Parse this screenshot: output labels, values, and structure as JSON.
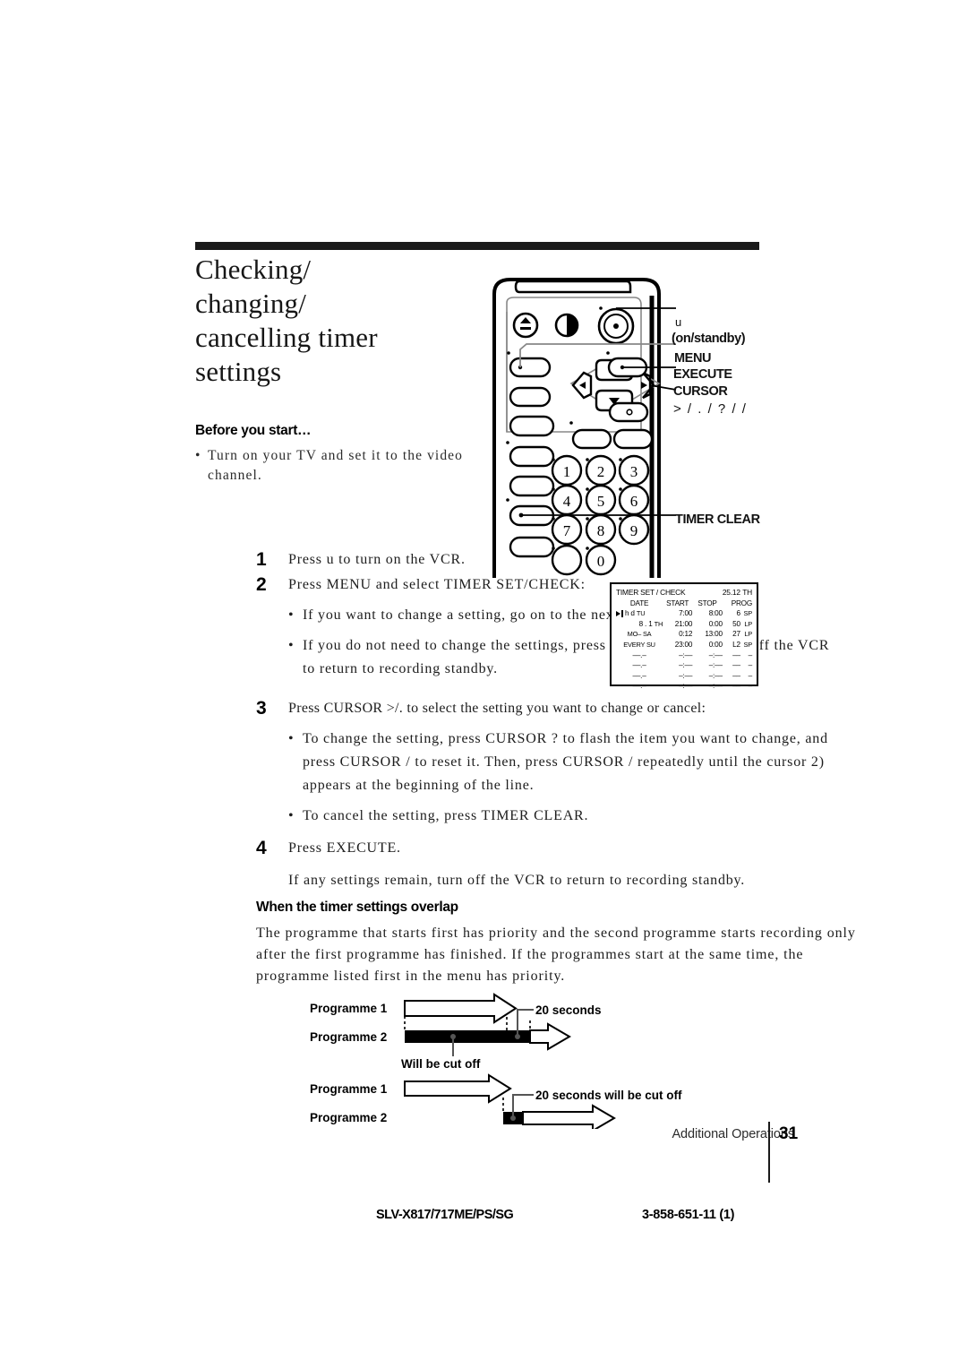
{
  "page": {
    "title_lines": [
      "Checking/",
      "changing/",
      "cancelling timer",
      "settings"
    ],
    "title_text": "Checking/ changing/ cancelling timer settings"
  },
  "before_you_start": {
    "heading": "Before you start…",
    "bullet_char": "•",
    "bullet": "Turn on your TV and set it to the video channel."
  },
  "remote": {
    "callouts": {
      "power_symbol": "u",
      "on_standby": "(on/standby)",
      "menu": "MENU",
      "execute": "EXECUTE",
      "cursor": "CURSOR",
      "cursor_arrows": "> / . / ? / /",
      "timer_clear": "TIMER CLEAR"
    },
    "keypad": [
      "1",
      "2",
      "3",
      "4",
      "5",
      "6",
      "7",
      "8",
      "9",
      "0"
    ]
  },
  "steps": [
    {
      "num": "1",
      "text": "Press u to turn on the VCR.",
      "subs": []
    },
    {
      "num": "2",
      "text": "Press MENU and select TIMER SET/CHECK:",
      "subs": [
        "If you want to change a setting, go on to the next step.",
        "If you do not need to change the settings, press EXECUTE, then turn off the VCR to return to recording standby."
      ]
    },
    {
      "num": "3",
      "text": "Press CURSOR >/. to select the setting you want to change or cancel:",
      "subs": [
        "To change the setting, press CURSOR ? to flash the item you want to change, and press CURSOR / to reset it.  Then, press CURSOR / repeatedly until the cursor 2) appears at the beginning of the line.",
        "To cancel the setting, press TIMER CLEAR."
      ]
    },
    {
      "num": "4",
      "text": "Press EXECUTE.",
      "subs": [],
      "note": "If any settings remain, turn off the VCR to return to recording standby."
    }
  ],
  "osd": {
    "title": "TIMER SET / CHECK",
    "date_now": "25.12",
    "day_now": "TH",
    "headers": [
      "DATE",
      "START",
      "STOP",
      "PROG"
    ],
    "rows": [
      {
        "cursor": true,
        "date": "h d",
        "day": "TU",
        "start": "7:00",
        "stop": "8:00",
        "prog": "6",
        "mode": "SP"
      },
      {
        "cursor": false,
        "date": "8 . 1",
        "day": "TH",
        "start": "21:00",
        "stop": "0:00",
        "prog": "50",
        "mode": "LP"
      },
      {
        "cursor": false,
        "date": "MO– SA",
        "day": "",
        "start": "0:12",
        "stop": "13:00",
        "prog": "27",
        "mode": "LP"
      },
      {
        "cursor": false,
        "date": "EVERY",
        "day": "SU",
        "start": "23:00",
        "stop": "0:00",
        "prog": "L2",
        "mode": "SP"
      },
      {
        "cursor": false,
        "date": "––.–",
        "day": "",
        "start": "–:––",
        "stop": "–:––",
        "prog": "––",
        "mode": "–"
      },
      {
        "cursor": false,
        "date": "––.–",
        "day": "",
        "start": "–:––",
        "stop": "–:––",
        "prog": "––",
        "mode": "–"
      },
      {
        "cursor": false,
        "date": "––.–",
        "day": "",
        "start": "–:––",
        "stop": "–:––",
        "prog": "––",
        "mode": "–"
      },
      {
        "cursor": false,
        "date": "––.–",
        "day": "",
        "start": "–:––",
        "stop": "–:––",
        "prog": "––",
        "mode": "–"
      }
    ]
  },
  "overlap": {
    "heading": "When the timer settings overlap",
    "body": "The programme that starts first has priority and the second programme starts recording only after the first programme has finished.  If the programmes start at the same time, the programme listed first in the menu has priority."
  },
  "diagram": {
    "case1": {
      "label_prog1": "Programme 1",
      "label_prog2": "Programme 2",
      "annotation_seconds": "20 seconds",
      "annotation_cutoff": "Will be cut off"
    },
    "case2": {
      "label_prog1": "Programme 1",
      "label_prog2": "Programme 2",
      "annotation": "20 seconds will be cut off"
    }
  },
  "footer": {
    "section": "Additional Operations",
    "page_number": "31",
    "model": "SLV-X817/717ME/PS/SG",
    "part_number": "3-858-651-11 (1)"
  }
}
